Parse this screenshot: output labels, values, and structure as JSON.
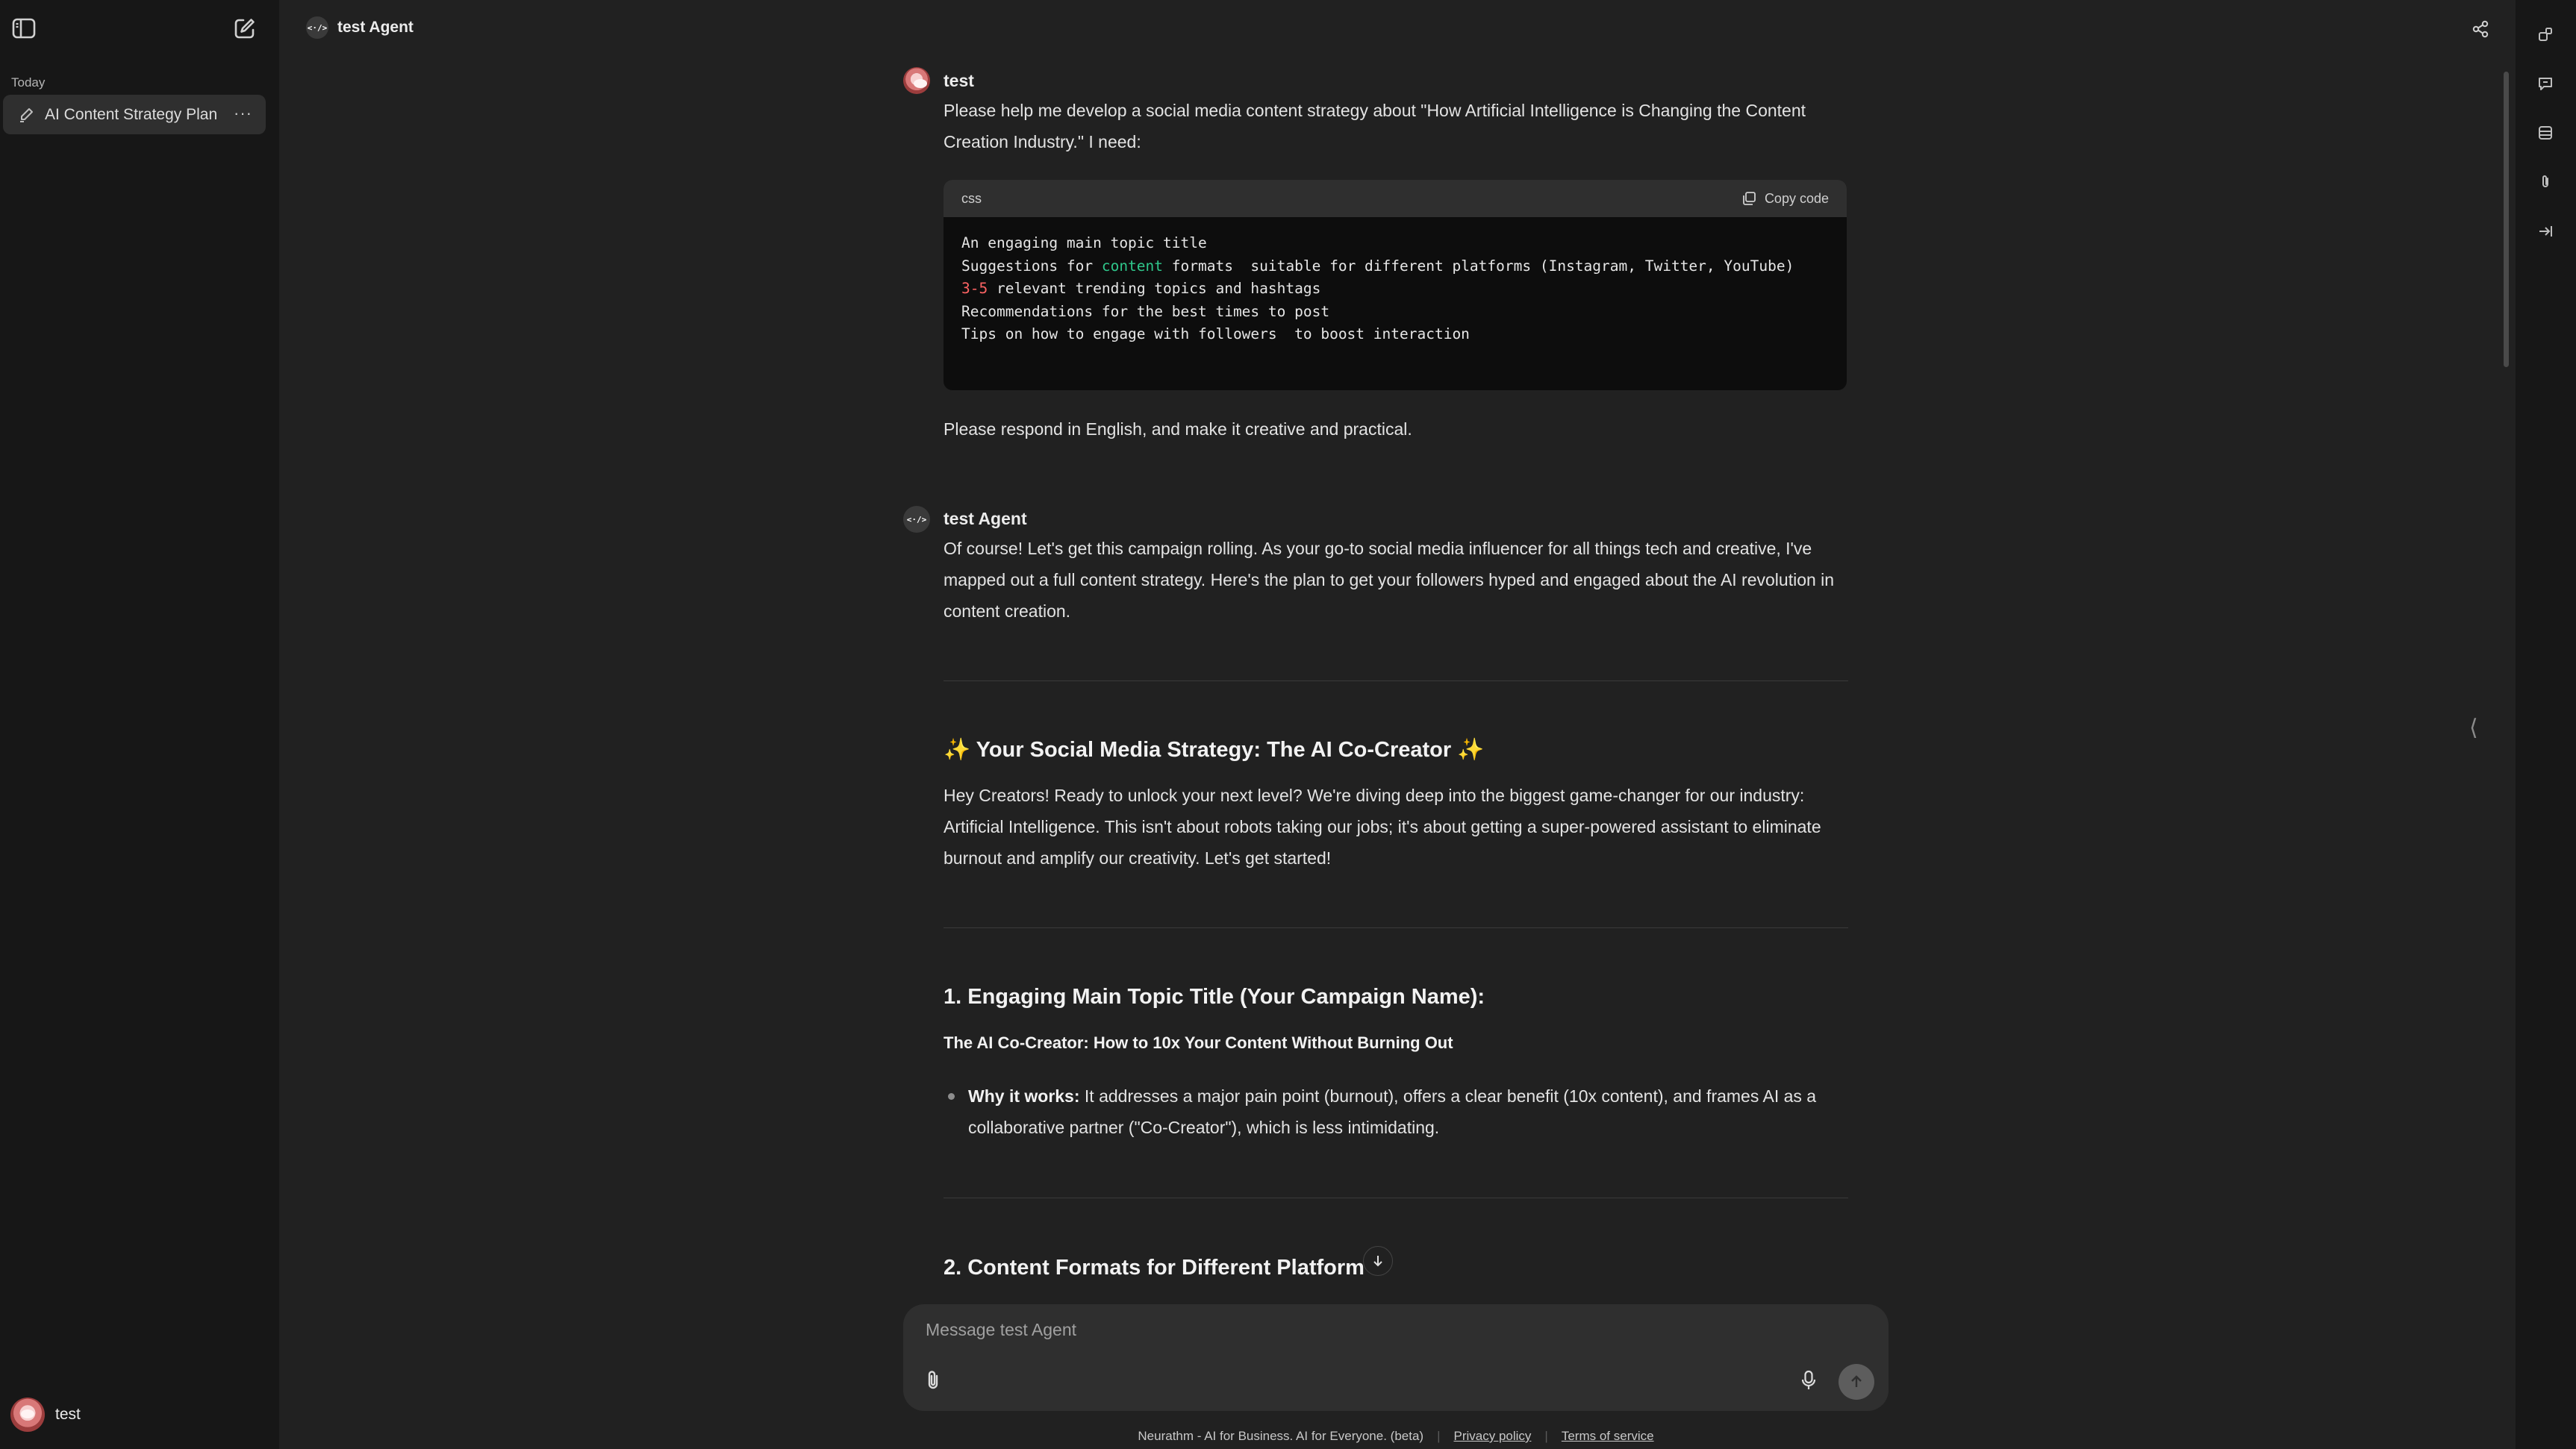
{
  "sidebar": {
    "section_label": "Today",
    "items": [
      {
        "label": "AI Content Strategy Plan",
        "more": "···"
      }
    ],
    "user": {
      "name": "test"
    }
  },
  "header": {
    "agent_name": "test Agent",
    "agent_logo_text": "<·/>"
  },
  "messages": {
    "user": {
      "author": "test",
      "intro": "Please help me develop a social media content strategy about \"How Artificial Intelligence is Changing the Content Creation Industry.\" I need:",
      "code": {
        "lang": "css",
        "copy_label": "Copy code",
        "lines": [
          "An engaging main topic title",
          "Suggestions for content formats  suitable for different platforms (Instagram, Twitter, YouTube)",
          "3-5 relevant trending topics and hashtags",
          "Recommendations for the best times to post",
          "Tips on how to engage with followers  to boost interaction"
        ]
      },
      "outro": "Please respond in English, and make it creative and practical."
    },
    "agent": {
      "author": "test Agent",
      "intro": "Of course! Let's get this campaign rolling. As your go-to social media influencer for all things tech and creative, I've mapped out a full content strategy. Here's the plan to get your followers hyped and engaged about the AI revolution in content creation.",
      "heading1": "✨ Your Social Media Strategy: The AI Co-Creator ✨",
      "para1": "Hey Creators! Ready to unlock your next level? We're diving deep into the biggest game-changer for our industry: Artificial Intelligence. This isn't about robots taking our jobs; it's about getting a super-powered assistant to eliminate burnout and amplify our creativity. Let's get started!",
      "heading2": "1. Engaging Main Topic Title (Your Campaign Name):",
      "campaign_title": "The AI Co-Creator: How to 10x Your Content Without Burning Out",
      "bullet_label": "Why it works:",
      "bullet_text": " It addresses a major pain point (burnout), offers a clear benefit (10x content), and frames AI as a collaborative partner (\"Co-Creator\"), which is less intimidating.",
      "heading3": "2. Content Formats for Different Platform"
    }
  },
  "composer": {
    "placeholder": "Message test Agent"
  },
  "footer": {
    "text": "Neurathm - AI for Business. AI for Everyone. (beta)",
    "privacy": "Privacy policy",
    "terms": "Terms of service"
  },
  "colors": {
    "background": "#212121",
    "sidebar": "#171717",
    "code_green": "#2fc78b",
    "code_red": "#ff6464"
  }
}
